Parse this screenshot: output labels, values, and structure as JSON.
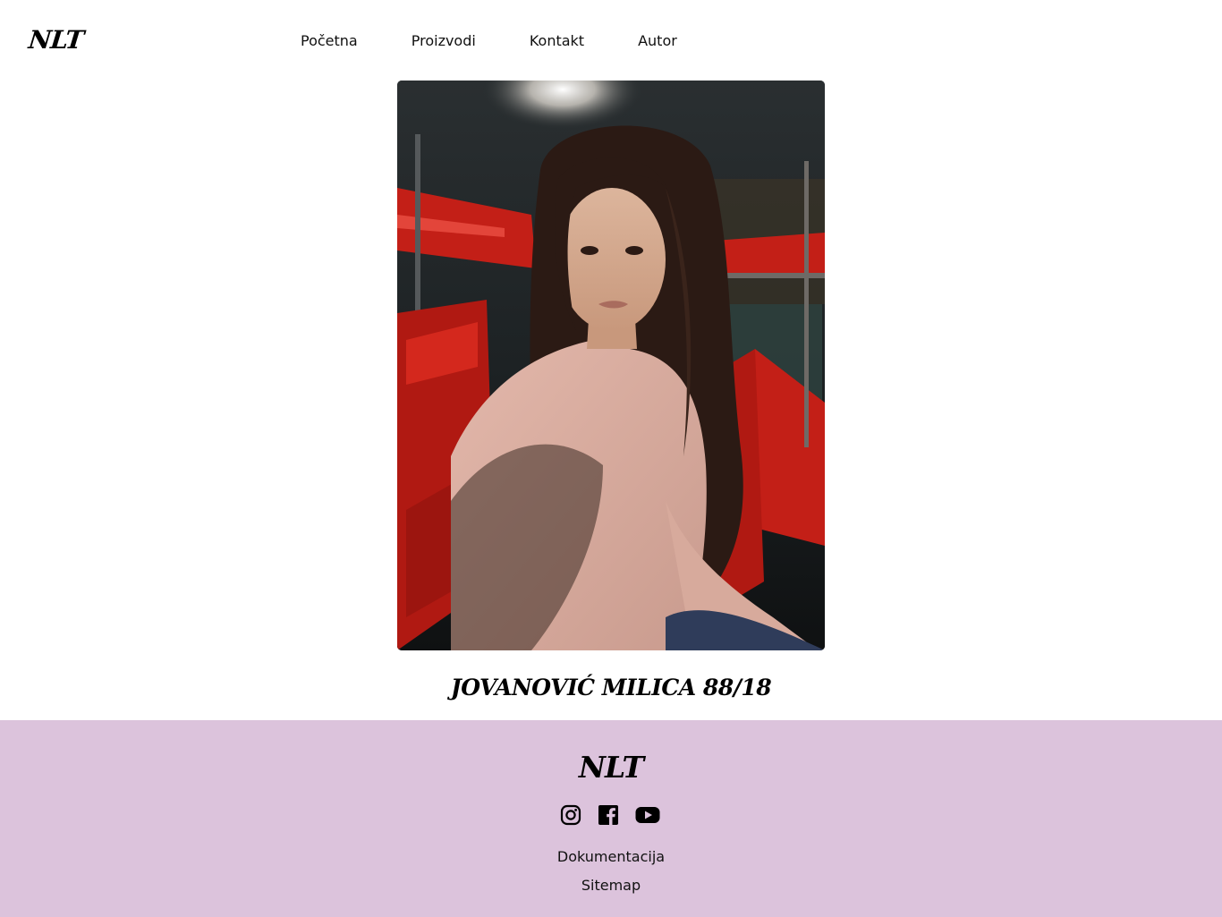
{
  "header": {
    "logo": "NLT",
    "nav": [
      {
        "label": "Početna"
      },
      {
        "label": "Proizvodi"
      },
      {
        "label": "Kontakt"
      },
      {
        "label": "Autor"
      }
    ]
  },
  "main": {
    "author_name": "JOVANOVIĆ MILICA 88/18"
  },
  "footer": {
    "logo": "NLT",
    "socials": [
      {
        "icon": "instagram-icon"
      },
      {
        "icon": "facebook-icon"
      },
      {
        "icon": "youtube-icon"
      }
    ],
    "links": [
      {
        "label": "Dokumentacija"
      },
      {
        "label": "Sitemap"
      }
    ]
  },
  "colors": {
    "footer_background": "#dcc3dc",
    "text": "#111111",
    "page_background": "#ffffff"
  }
}
